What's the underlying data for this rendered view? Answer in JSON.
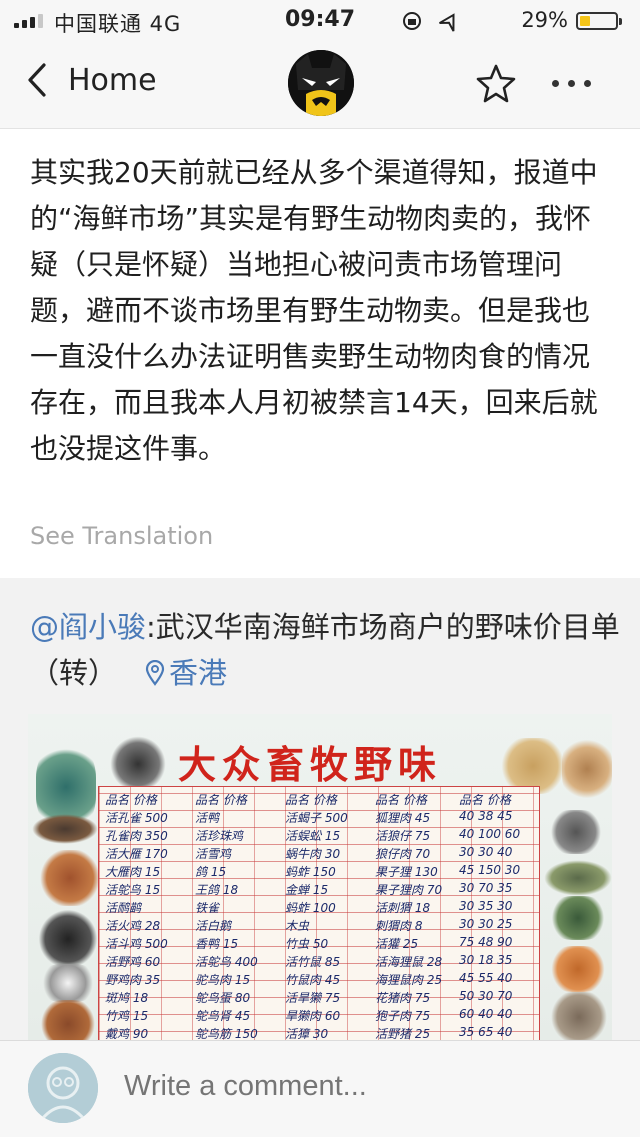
{
  "status_bar": {
    "carrier": "中国联通  4G",
    "time": "09:47",
    "battery_percent": "29%",
    "battery_level": 0.29
  },
  "nav": {
    "back_label": "Home"
  },
  "post": {
    "text": "其实我20天前就已经从多个渠道得知，报道中的“海鲜市场”其实是有野生动物肉卖的，我怀疑（只是怀疑）当地担心被问责市场管理问题，避而不谈市场里有野生动物卖。但是我也一直没什么办法证明售卖野生动物肉食的情况存在，而且我本人月初被禁言14天，回来后就也没提这件事。",
    "see_translation": "See Translation"
  },
  "repost": {
    "mention": "@阎小骏",
    "text": ":武汉华南海鲜市场商户的野味价目单（转）",
    "location": "香港",
    "image": {
      "title": "大众畜牧野味"
    }
  },
  "comment_bar": {
    "placeholder": "Write a comment..."
  },
  "colors": {
    "link": "#4a7ab8",
    "poster_title": "#d0241b",
    "battery": "#f5c518"
  },
  "icons": [
    "signal-icon",
    "battery-icon",
    "back-chevron-icon",
    "star-icon",
    "more-icon",
    "location-pin-icon"
  ]
}
